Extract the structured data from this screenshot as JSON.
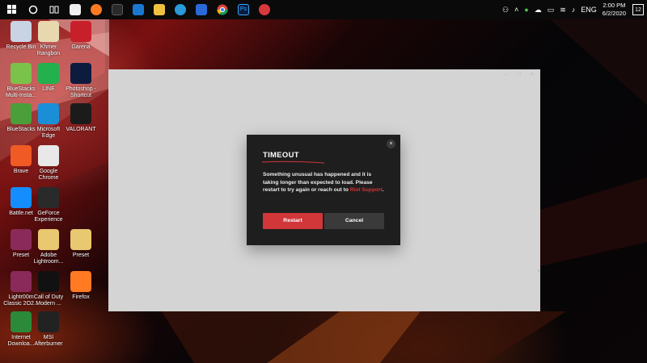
{
  "colors": {
    "riot_red": "#d13639",
    "dialog_bg": "#1e1e1e",
    "window_bg": "#d4d4d4",
    "taskbar_bg": "#0a0a0a"
  },
  "taskbar": {
    "pinned": [
      {
        "name": "start-icon"
      },
      {
        "name": "search-circle-icon"
      },
      {
        "name": "task-view-icon"
      },
      {
        "name": "store-icon"
      },
      {
        "name": "firefox-icon"
      },
      {
        "name": "gaming-app-icon"
      },
      {
        "name": "mail-icon"
      },
      {
        "name": "file-explorer-icon"
      },
      {
        "name": "edge-icon"
      },
      {
        "name": "defender-icon"
      },
      {
        "name": "chrome-icon"
      },
      {
        "name": "photoshop-icon"
      },
      {
        "name": "telegram-icon"
      }
    ],
    "tray": {
      "language": "ENG",
      "time": "2:00 PM",
      "date": "6/2/2020",
      "notification_count": "12"
    }
  },
  "desktop_icons": [
    {
      "label": "Recycle Bin",
      "icon": "recycle-bin-icon",
      "color": "#c8d4e4"
    },
    {
      "label": "Khmer Rangbon",
      "icon": "document-icon",
      "color": "#e8d8b0"
    },
    {
      "label": "Garena",
      "icon": "garena-icon",
      "color": "#c8202a"
    },
    {
      "label": "BlueStacks Multi-Insta...",
      "icon": "bluestacks-multi-icon",
      "color": "#7bc24a"
    },
    {
      "label": "LINE",
      "icon": "line-icon",
      "color": "#22b14c"
    },
    {
      "label": "Photoshop - Shortcut",
      "icon": "photoshop-icon",
      "color": "#0d1b3e"
    },
    {
      "label": "BlueStacks",
      "icon": "bluestacks-icon",
      "color": "#4a9f3a"
    },
    {
      "label": "Microsoft Edge",
      "icon": "edge-icon",
      "color": "#1a8fd8"
    },
    {
      "label": "VALORANT",
      "icon": "valorant-icon",
      "color": "#1b1b1b"
    },
    {
      "label": "Brave",
      "icon": "brave-icon",
      "color": "#f05a24"
    },
    {
      "label": "Google Chrome",
      "icon": "chrome-icon",
      "color": "#e8e8e8"
    },
    {
      "label": "Battle.net",
      "icon": "battlenet-icon",
      "color": "#148eff"
    },
    {
      "label": "GeForce Experience",
      "icon": "geforce-icon",
      "color": "#2a2a2a"
    },
    {
      "label": "Preset",
      "icon": "winrar-icon",
      "color": "#8a2a5a"
    },
    {
      "label": "Adobe Lightroom...",
      "icon": "folder-icon",
      "color": "#e8c870"
    },
    {
      "label": "Preset",
      "icon": "folder-icon",
      "color": "#e8c870"
    },
    {
      "label": "Lightr00m Classic 2O2...",
      "icon": "winrar-icon",
      "color": "#8a2a5a"
    },
    {
      "label": "Call of Duty Modern ...",
      "icon": "codmw-icon",
      "color": "#111111"
    },
    {
      "label": "Firefox",
      "icon": "firefox-icon",
      "color": "#ff7a22"
    },
    {
      "label": "Internet Downloa...",
      "icon": "idm-icon",
      "color": "#2a8a3a"
    },
    {
      "label": "MSI Afterburner",
      "icon": "afterburner-icon",
      "color": "#222222"
    }
  ],
  "dialog": {
    "title": "TIMEOUT",
    "message_before_link": "Something unusual has happened and it is taking longer than expected to load. Please restart to try again or reach out to ",
    "link_text": "Riot Support",
    "message_after_link": ".",
    "close_glyph": "×",
    "restart_label": "Restart",
    "cancel_label": "Cancel"
  }
}
